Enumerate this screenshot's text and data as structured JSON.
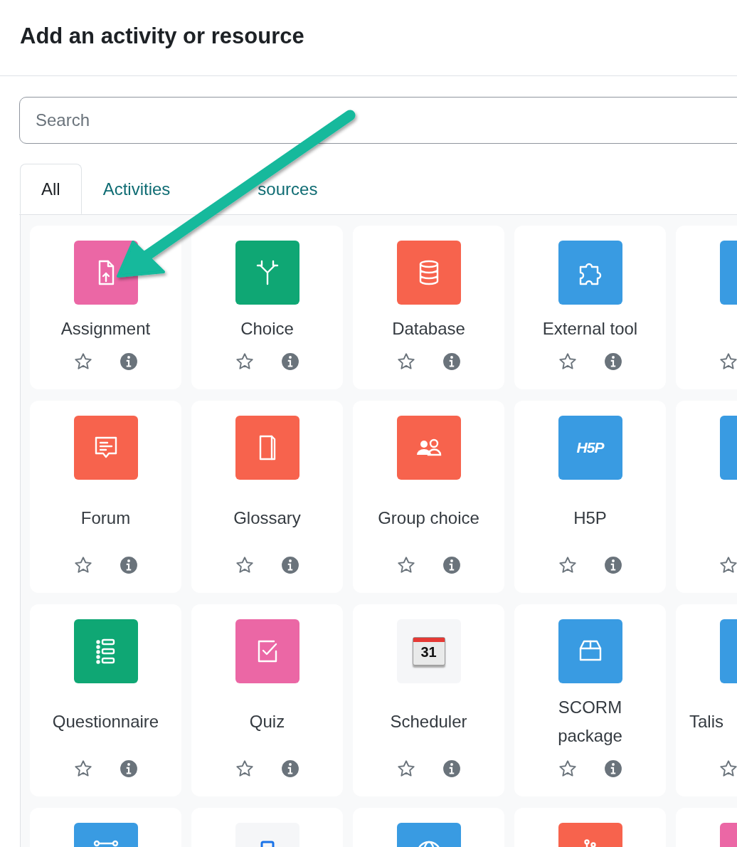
{
  "dialog": {
    "title": "Add an activity or resource"
  },
  "search": {
    "placeholder": "Search"
  },
  "tabs": [
    {
      "label": "All",
      "selected": true
    },
    {
      "label": "Activities",
      "selected": false
    },
    {
      "label": "sources",
      "selected": false
    }
  ],
  "items": [
    {
      "name": "Assignment",
      "kind": "assignment",
      "color": "#eb67a5",
      "starred": false
    },
    {
      "name": "Choice",
      "kind": "choice",
      "color": "#0fa774",
      "starred": false
    },
    {
      "name": "Database",
      "kind": "database",
      "color": "#f7634d",
      "starred": false
    },
    {
      "name": "External tool",
      "kind": "puzzle",
      "color": "#399be2",
      "starred": false
    },
    {
      "kind": "blank",
      "color": "#399be2",
      "starred": false
    },
    {
      "name": "Forum",
      "kind": "forum",
      "color": "#f7634d",
      "starred": false
    },
    {
      "name": "Glossary",
      "kind": "book",
      "color": "#f7634d",
      "starred": false
    },
    {
      "name": "Group choice",
      "kind": "people",
      "color": "#f7634d",
      "starred": false
    },
    {
      "name": "H5P",
      "kind": "logo",
      "icon_label": "H5P",
      "color": "#399be2",
      "starred": false
    },
    {
      "kind": "blank",
      "color": "#399be2",
      "starred": false
    },
    {
      "name": "Questionnaire",
      "kind": "list",
      "color": "#0fa774",
      "starred": false
    },
    {
      "name": "Quiz",
      "kind": "checkbox",
      "color": "#eb67a5",
      "starred": false
    },
    {
      "name": "Scheduler",
      "kind": "calendar",
      "icon_label": "31",
      "color": "#f5f6f8",
      "starred": false
    },
    {
      "name": "SCORM package",
      "kind": "box",
      "color": "#399be2",
      "starred": false
    },
    {
      "name": "Talis",
      "kind": "blank",
      "color": "#399be2",
      "starred": false
    },
    {
      "kind": "nodes",
      "color": "#399be2"
    },
    {
      "kind": "square",
      "color": "#f5f6f8"
    },
    {
      "kind": "globe",
      "color": "#399be2"
    },
    {
      "kind": "branches",
      "color": "#f7634d"
    },
    {
      "kind": "blank",
      "color": "#eb67a5"
    }
  ],
  "annotation": {
    "kind": "arrow"
  }
}
